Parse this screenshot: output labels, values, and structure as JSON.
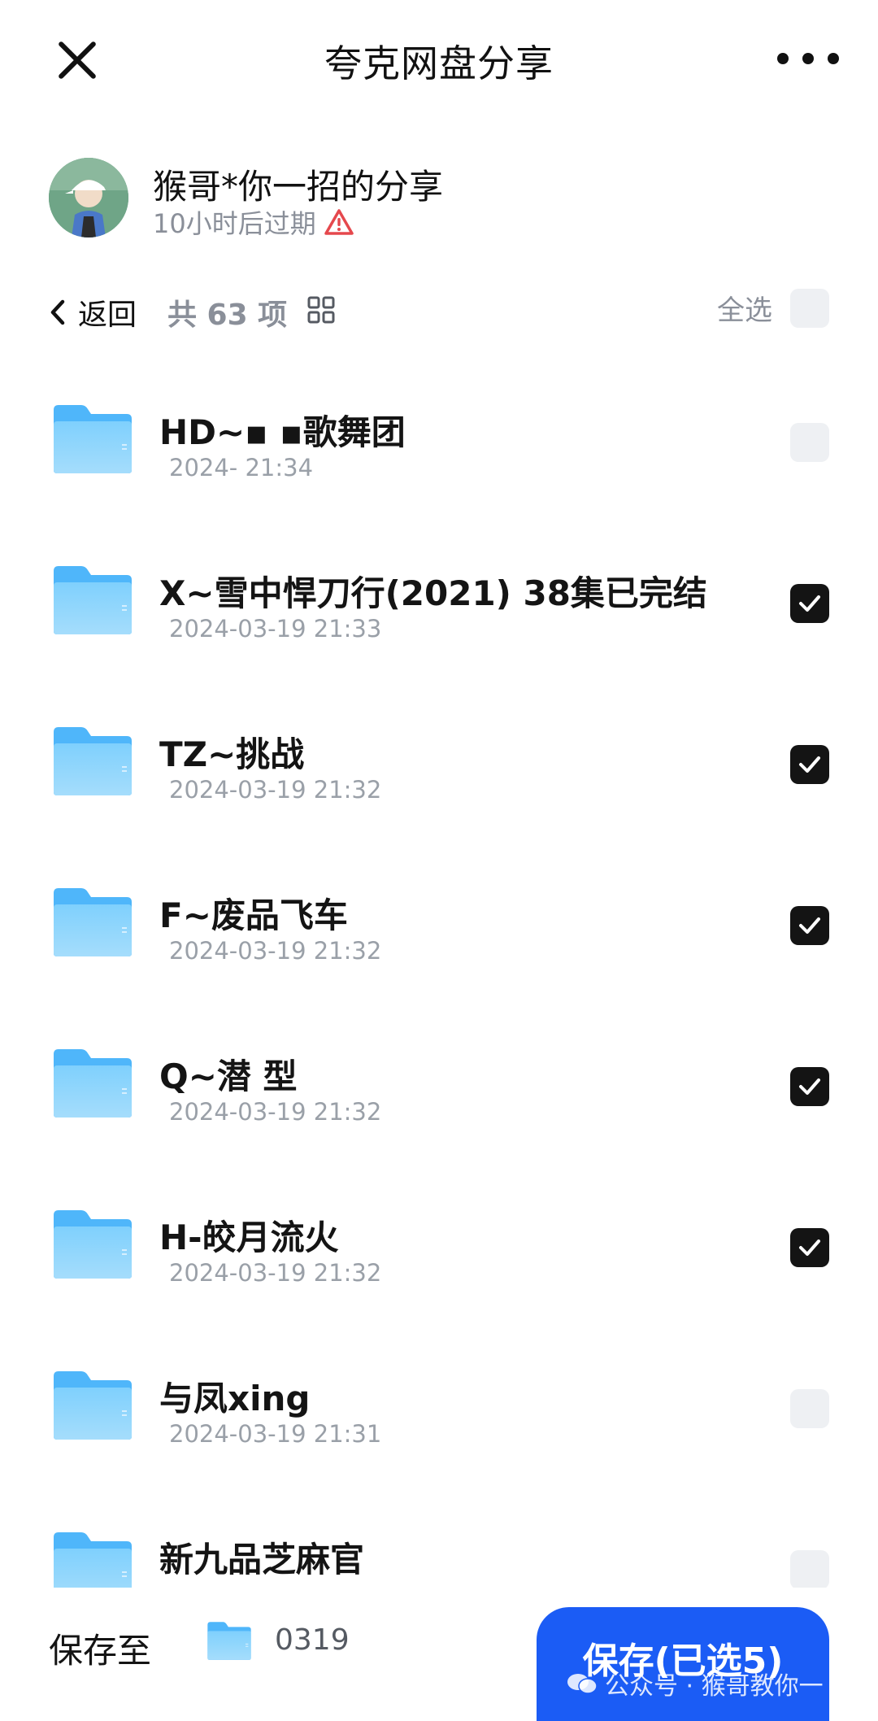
{
  "header": {
    "title": "夸克网盘分享",
    "close_icon": "close-icon",
    "more_icon": "more-dots-icon"
  },
  "sharer": {
    "name": "猴哥*你一招的分享",
    "expire_text": "10小时后过期",
    "warning_icon": "warning-triangle-icon"
  },
  "toolbar": {
    "back_label": "返回",
    "count_text": "共 63 项",
    "select_all_label": "全选"
  },
  "files": [
    {
      "name": "HD~▪ ▪歌舞团",
      "date": "2024-   21:34",
      "checked": false
    },
    {
      "name": "X~雪中悍刀行(2021) 38集已完结",
      "date": "2024-03-19 21:33",
      "checked": true
    },
    {
      "name": "TZ~挑战",
      "date": "2024-03-19 21:32",
      "checked": true
    },
    {
      "name": "F~废品飞车",
      "date": "2024-03-19 21:32",
      "checked": true
    },
    {
      "name": "Q~潜 型",
      "date": "2024-03-19 21:32",
      "checked": true
    },
    {
      "name": "H-皎月流火",
      "date": "2024-03-19 21:32",
      "checked": true
    },
    {
      "name": "与凤xing",
      "date": "2024-03-19 21:31",
      "checked": false
    },
    {
      "name": "新九品芝麻官",
      "date": "",
      "checked": false
    }
  ],
  "bottom": {
    "save_to_label": "保存至",
    "destination_folder": "0319",
    "save_button_label": "保存(已选5)"
  },
  "watermark": {
    "text": "公众号 · 猴哥教你一"
  },
  "colors": {
    "accent": "#1b5cf5",
    "folder": "#6fc3fb",
    "checkbox_checked": "#141414",
    "warning": "#e5484d"
  }
}
